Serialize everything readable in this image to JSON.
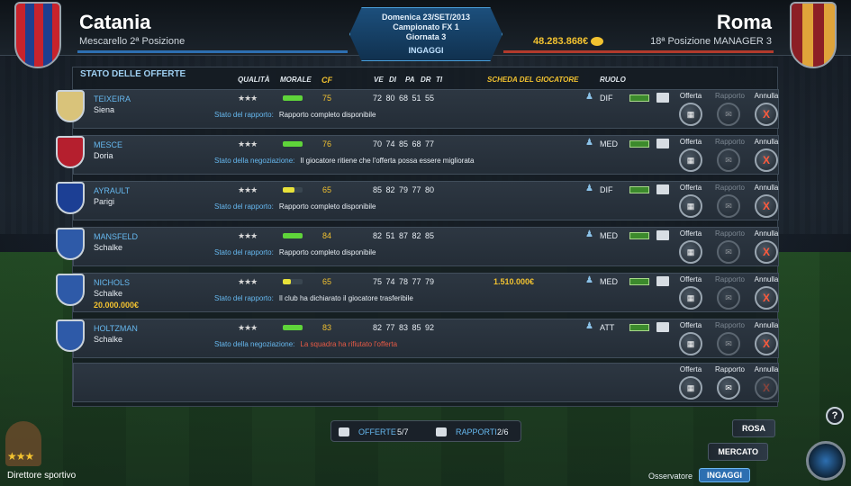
{
  "header": {
    "home_team": "Catania",
    "home_sub": "Mescarello  2ª Posizione",
    "away_team": "Roma",
    "away_sub": "18ª Posizione  MANAGER 3",
    "money": "48.283.868€",
    "date": "Domenica 23/SET/2013",
    "competition": "Campionato FX 1",
    "matchday": "Giornata 3",
    "section": "INGAGGI"
  },
  "table": {
    "title": "STATO DELLE OFFERTE",
    "columns": [
      "QUALITÀ",
      "MORALE",
      "CF",
      "VE",
      "DI",
      "PA",
      "DR",
      "TI",
      "SCHEDA DEL GIOCATORE",
      "RUOLO"
    ]
  },
  "action_labels": {
    "offer": "Offerta",
    "report": "Rapporto",
    "cancel": "Annulla"
  },
  "rows": [
    {
      "name": "TEIXEIRA",
      "club": "Siena",
      "extra": "",
      "stars": "★★★",
      "morale": 1.0,
      "cf": "75",
      "stats": "72  80  68  51  55",
      "price": "",
      "role": "DIF",
      "status_label": "Stato del rapporto:",
      "status_value": "Rapporto completo disponibile",
      "negative": false
    },
    {
      "name": "MESCE",
      "club": "Doria",
      "extra": "",
      "stars": "★★★",
      "morale": 1.0,
      "cf": "76",
      "stats": "70  74  85  68  77",
      "price": "",
      "role": "MED",
      "status_label": "Stato della negoziazione:",
      "status_value": "Il giocatore ritiene che l'offerta possa essere migliorata",
      "negative": false
    },
    {
      "name": "AYRAULT",
      "club": "Parigi",
      "extra": "",
      "stars": "★★★",
      "morale": 0.6,
      "cf": "65",
      "stats": "85  82  79  77  80",
      "price": "",
      "role": "DIF",
      "status_label": "Stato del rapporto:",
      "status_value": "Rapporto completo disponibile",
      "negative": false
    },
    {
      "name": "MANSFELD",
      "club": "Schalke",
      "extra": "",
      "stars": "★★★",
      "morale": 1.0,
      "cf": "84",
      "stats": "82  51  87  82  85",
      "price": "",
      "role": "MED",
      "status_label": "Stato del rapporto:",
      "status_value": "Rapporto completo disponibile",
      "negative": false
    },
    {
      "name": "NICHOLS",
      "club": "Schalke",
      "extra": "20.000.000€",
      "stars": "★★★",
      "morale": 0.4,
      "cf": "65",
      "stats": "75  74  78  77  79",
      "price": "1.510.000€",
      "role": "MED",
      "status_label": "Stato del rapporto:",
      "status_value": "Il club ha dichiarato il giocatore trasferibile",
      "negative": false
    },
    {
      "name": "HOLTZMAN",
      "club": "Schalke",
      "extra": "",
      "stars": "★★★",
      "morale": 1.0,
      "cf": "83",
      "stats": "82  77  83  85  92",
      "price": "",
      "role": "ATT",
      "status_label": "Stato della negoziazione:",
      "status_value": "La squadra ha rifiutato l'offerta",
      "negative": true
    }
  ],
  "footer": {
    "offers_label": "OFFERTE",
    "offers_count": "5/7",
    "reports_label": "RAPPORTI",
    "reports_count": "2/6",
    "director_title": "Direttore sportivo",
    "director_stars": "★★★",
    "menu_rosa": "ROSA",
    "menu_mercato": "MERCATO",
    "observer": "Osservatore",
    "ingaggi": "INGAGGI",
    "help": "?"
  },
  "colors": {
    "accent_blue": "#66b8ef",
    "gold": "#f2c230",
    "cancel_red": "#ff5a3c",
    "negative_text": "#e85a45"
  }
}
